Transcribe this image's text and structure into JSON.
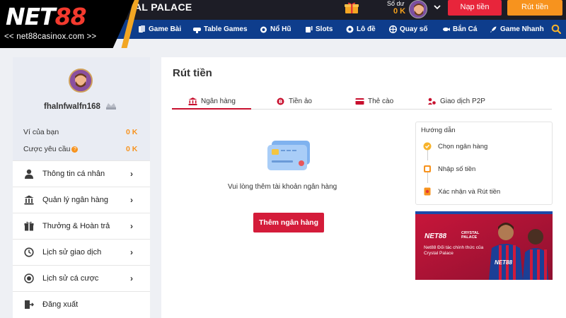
{
  "brand": {
    "logo_text": "NET",
    "logo_num": "88",
    "url": "<< net88casinox.com >>"
  },
  "header": {
    "marquee": "AL PALACE",
    "balance_label": "Số dư",
    "balance_value": "0 K",
    "deposit_label": "Nạp tiền",
    "withdraw_label": "Rút tiền"
  },
  "nav": [
    {
      "label": "Game Bài",
      "icon": "cards-icon"
    },
    {
      "label": "Table Games",
      "icon": "table-games-icon"
    },
    {
      "label": "Nổ Hũ",
      "icon": "jackpot-icon"
    },
    {
      "label": "Slots",
      "icon": "slots-icon"
    },
    {
      "label": "Lô đề",
      "icon": "lottery-ball-icon"
    },
    {
      "label": "Quay số",
      "icon": "wheel-icon"
    },
    {
      "label": "Bắn Cá",
      "icon": "fish-icon"
    },
    {
      "label": "Game Nhanh",
      "icon": "rocket-icon"
    }
  ],
  "sidebar": {
    "username": "fhalnfwalfn168",
    "wallet_label": "Ví của bạn",
    "wallet_value": "0 K",
    "wager_label": "Cược yêu cầu",
    "wager_value": "0 K",
    "items": [
      {
        "label": "Thông tin cá nhân",
        "icon": "user-icon"
      },
      {
        "label": "Quản lý ngân hàng",
        "icon": "bank-icon"
      },
      {
        "label": "Thưởng & Hoàn trả",
        "icon": "gift-icon"
      },
      {
        "label": "Lịch sử giao dịch",
        "icon": "history-icon"
      },
      {
        "label": "Lịch sử cá cược",
        "icon": "bet-history-icon"
      },
      {
        "label": "Đăng xuất",
        "icon": "logout-icon"
      }
    ]
  },
  "main": {
    "title": "Rút tiền",
    "tabs": [
      {
        "label": "Ngân hàng",
        "icon": "bank-icon"
      },
      {
        "label": "Tiền ảo",
        "icon": "crypto-icon"
      },
      {
        "label": "Thẻ cào",
        "icon": "card-icon"
      },
      {
        "label": "Giao dịch P2P",
        "icon": "p2p-icon"
      }
    ],
    "empty_message": "Vui lòng thêm tài khoản ngân hàng",
    "add_bank_label": "Thêm ngân hàng",
    "guide": {
      "title": "Hướng dẫn",
      "steps": [
        "Chọn ngân hàng",
        "Nhập số tiền",
        "Xác nhận và Rút tiền"
      ]
    },
    "banner": {
      "logo": "NET88",
      "partner_line1": "CRYSTAL",
      "partner_line2": "PALACE",
      "text": "Net88 Đối tác chính thức của Crystal Palace",
      "jersey": "NET88"
    }
  },
  "colors": {
    "nav_bg": "#0e3d8c",
    "topbar_bg": "#1d1d26",
    "accent_red": "#d41c3a",
    "accent_orange": "#f7931e"
  }
}
